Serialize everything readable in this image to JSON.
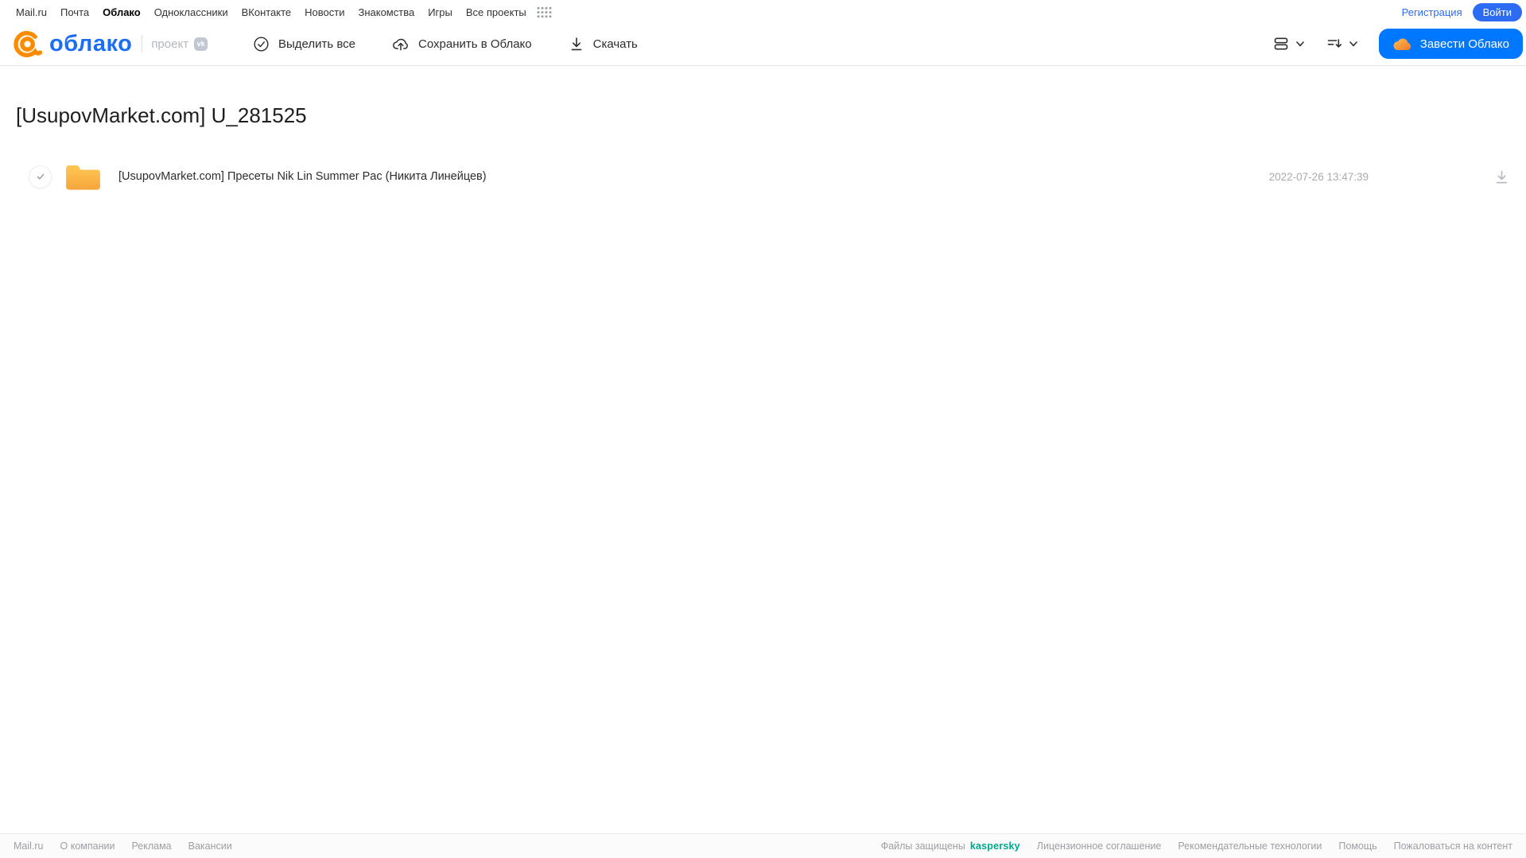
{
  "colors": {
    "accent_blue": "#0077ff",
    "login_blue": "#2c6bf2",
    "logo_blue": "#1b6ef3",
    "brand_orange": "#fc8b00",
    "folder_yellow_top": "#ffc753",
    "folder_yellow_bottom": "#f5a63a",
    "kaspersky_green": "#00a88e"
  },
  "topbar": {
    "links": [
      "Mail.ru",
      "Почта",
      "Облако",
      "Одноклассники",
      "ВКонтакте",
      "Новости",
      "Знакомства",
      "Игры",
      "Все проекты"
    ],
    "active_link": "Облако",
    "register": "Регистрация",
    "login": "Войти"
  },
  "header": {
    "logo": "облако",
    "project": "проект",
    "vk_badge": "vk",
    "select_all": "Выделить все",
    "save_to_cloud": "Сохранить в Облако",
    "download": "Скачать",
    "get_cloud": "Завести Облако"
  },
  "page": {
    "title": "[UsupovMarket.com] U_281525"
  },
  "files": [
    {
      "type": "folder",
      "name": "[UsupovMarket.com] Пресеты Nik Lin Summer Pac (Никита Линейцев)",
      "date": "2022-07-26 13:47:39"
    }
  ],
  "footer": {
    "links_left": [
      "Mail.ru",
      "О компании",
      "Реклама",
      "Вакансии"
    ],
    "protected": "Файлы защищены",
    "kaspersky": "kaspersky",
    "links_right": [
      "Лицензионное соглашение",
      "Рекомендательные технологии",
      "Помощь",
      "Пожаловаться на контент"
    ]
  }
}
